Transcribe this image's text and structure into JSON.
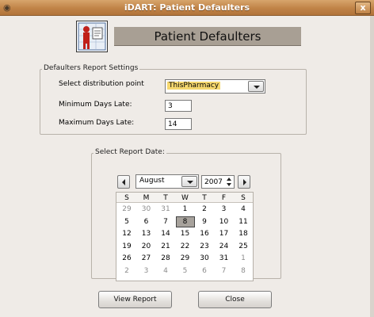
{
  "window": {
    "title": "iDART: Patient Defaulters",
    "close_glyph": "x",
    "menu_glyph": "◉"
  },
  "header": {
    "title": "Patient Defaulters",
    "icon": "patient-report-icon"
  },
  "settings": {
    "legend": "Defaulters Report Settings",
    "distribution_label": "Select distribution point",
    "distribution_value": "ThisPharmacy",
    "min_days_label": "Minimum Days Late:",
    "min_days_value": "3",
    "max_days_label": "Maximum Days Late:",
    "max_days_value": "14"
  },
  "calendar": {
    "legend": "Select Report Date:",
    "month": "August",
    "year": "2007",
    "weekdays": [
      "S",
      "M",
      "T",
      "W",
      "T",
      "F",
      "S"
    ],
    "weeks": [
      [
        {
          "d": "29",
          "dim": true
        },
        {
          "d": "30",
          "dim": true
        },
        {
          "d": "31",
          "dim": true
        },
        {
          "d": "1"
        },
        {
          "d": "2"
        },
        {
          "d": "3"
        },
        {
          "d": "4"
        }
      ],
      [
        {
          "d": "5"
        },
        {
          "d": "6"
        },
        {
          "d": "7"
        },
        {
          "d": "8",
          "selected": true
        },
        {
          "d": "9"
        },
        {
          "d": "10"
        },
        {
          "d": "11"
        }
      ],
      [
        {
          "d": "12"
        },
        {
          "d": "13"
        },
        {
          "d": "14"
        },
        {
          "d": "15"
        },
        {
          "d": "16"
        },
        {
          "d": "17"
        },
        {
          "d": "18"
        }
      ],
      [
        {
          "d": "19"
        },
        {
          "d": "20"
        },
        {
          "d": "21"
        },
        {
          "d": "22"
        },
        {
          "d": "23"
        },
        {
          "d": "24"
        },
        {
          "d": "25"
        }
      ],
      [
        {
          "d": "26"
        },
        {
          "d": "27"
        },
        {
          "d": "28"
        },
        {
          "d": "29"
        },
        {
          "d": "30"
        },
        {
          "d": "31"
        },
        {
          "d": "1",
          "dim": true
        }
      ],
      [
        {
          "d": "2",
          "dim": true
        },
        {
          "d": "3",
          "dim": true
        },
        {
          "d": "4",
          "dim": true
        },
        {
          "d": "5",
          "dim": true
        },
        {
          "d": "6",
          "dim": true
        },
        {
          "d": "7",
          "dim": true
        },
        {
          "d": "8",
          "dim": true
        }
      ]
    ]
  },
  "buttons": {
    "view_report": "View Report",
    "close": "Close"
  },
  "colors": {
    "titlebar": "#c08347",
    "window_bg": "#efebe7",
    "banner": "#a89f94",
    "highlight": "#f5d76e"
  }
}
